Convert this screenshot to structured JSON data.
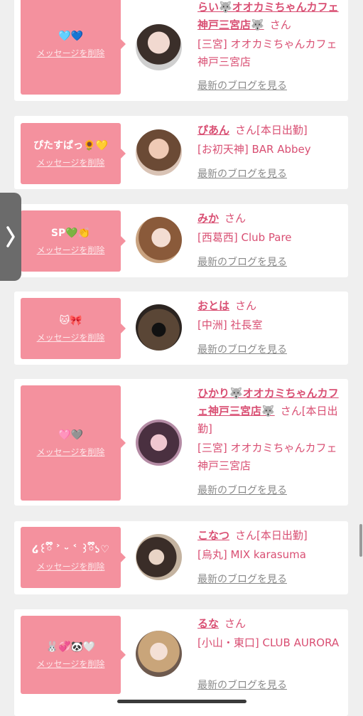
{
  "delete_label": "メッセージを削除",
  "blog_label": "最新のブログを見る",
  "san": "さん",
  "colors": {
    "bubble": "#f4919e",
    "accent": "#d94f73",
    "background": "#efefef"
  },
  "cards": [
    {
      "message": "🩵💙",
      "name": "らい🐺オオカミちゃんカフェ神戸三宮店🐺",
      "status": "",
      "shop": "[三宮] オオカミちゃんカフェ神戸三宮店"
    },
    {
      "message": "ぴたすぱっ🌻💛",
      "name": "ぴあん",
      "status": "[本日出勤]",
      "shop": "[お初天神] BAR Abbey"
    },
    {
      "message": "SP💚👏",
      "name": "みか",
      "status": "",
      "shop": "[西葛西] Club Pare"
    },
    {
      "message": "🐱🎀",
      "name": "おとは",
      "status": "",
      "shop": "[中洲] 社長室"
    },
    {
      "message": "🩷🩶",
      "name": "ひかり🐺オオカミちゃんカフェ神戸三宮店🐺",
      "status": "[本日出勤]",
      "shop": "[三宮] オオカミちゃんカフェ神戸三宮店"
    },
    {
      "message": "໒꒰ྀི ˃ ᵕ ˂ ꒱ྀི১♡",
      "name": "こなつ",
      "status": "[本日出勤]",
      "shop": "[烏丸] MIX karasuma"
    },
    {
      "message": "🐰💞🐼🤍",
      "name": "るな",
      "status": "",
      "shop": "[小山・東口] CLUB AURORA"
    }
  ]
}
